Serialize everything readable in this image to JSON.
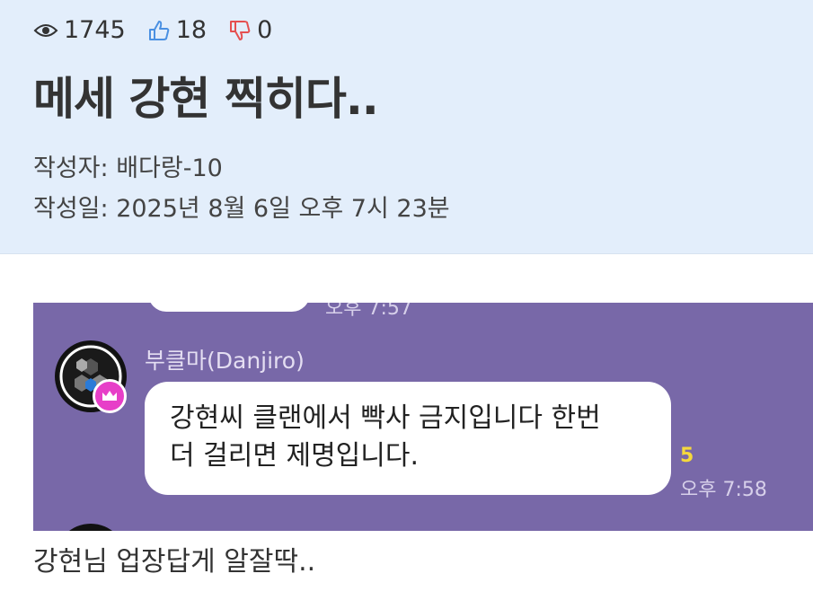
{
  "post": {
    "views": "1745",
    "likes": "18",
    "dislikes": "0",
    "title": "메세 강현 찍히다..",
    "author_line": "작성자: 배다랑-10",
    "date_line": "작성일: 2025년 8월 6일 오후 7시 23분",
    "caption": "강현님 업장답게 알잘딱.."
  },
  "chat": {
    "prev_time": "오후 7:57",
    "sender": "부클마(Danjiro)",
    "message_line1": "강현씨 클랜에서 빡사 금지입니다 한번",
    "message_line2": "더 걸리면 제명입니다.",
    "read_count": "5",
    "time": "오후 7:58",
    "background_color": "#7868a8",
    "crown_badge_color": "#e73fc8"
  },
  "icons": [
    "eye-icon",
    "thumbs-up-icon",
    "thumbs-down-icon",
    "crown-icon"
  ]
}
